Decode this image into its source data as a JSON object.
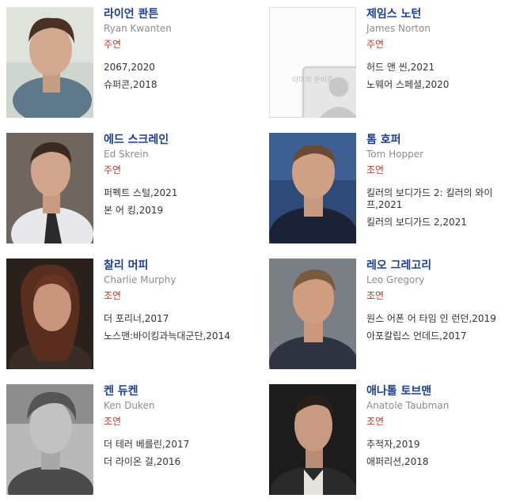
{
  "placeholder_text": "이미지 준비중",
  "colors": {
    "name": "#1a3f8c",
    "english_name": "#8c8c8c",
    "role": "#c0392b",
    "work": "#333333"
  },
  "cast": [
    {
      "korean_name": "라이언 콴튼",
      "english_name": "Ryan Kwanten",
      "role": "주연",
      "works": [
        "2067,2020",
        "슈퍼콘,2018"
      ]
    },
    {
      "korean_name": "제임스 노턴",
      "english_name": "James Norton",
      "role": "주연",
      "works": [
        "허드 앤 씬,2021",
        "노웨어 스페셜,2020"
      ]
    },
    {
      "korean_name": "에드 스크레인",
      "english_name": "Ed Skrein",
      "role": "주연",
      "works": [
        "퍼펙트 스털,2021",
        "본 어 킹,2019"
      ]
    },
    {
      "korean_name": "톰 호퍼",
      "english_name": "Tom Hopper",
      "role": "조연",
      "works": [
        "킬러의 보디가드 2: 킬러의 와이프,2021",
        "킬러의 보디가드 2,2021"
      ]
    },
    {
      "korean_name": "찰리 머피",
      "english_name": "Charlie Murphy",
      "role": "조연",
      "works": [
        "더 포리너,2017",
        "노스맨:바이킹과늑대군단,2014"
      ]
    },
    {
      "korean_name": "레오 그레고리",
      "english_name": "Leo Gregory",
      "role": "조연",
      "works": [
        "원스 어폰 어 타임 인 런던,2019",
        "아포칼립스 언데드,2017"
      ]
    },
    {
      "korean_name": "켄 듀켄",
      "english_name": "Ken Duken",
      "role": "조연",
      "works": [
        "더 테러 베를린,2017",
        "더 라이온 걸,2016"
      ]
    },
    {
      "korean_name": "애나톨 토브맨",
      "english_name": "Anatole Taubman",
      "role": "조연",
      "works": [
        "추적자,2019",
        "애퍼리션,2018"
      ]
    }
  ]
}
